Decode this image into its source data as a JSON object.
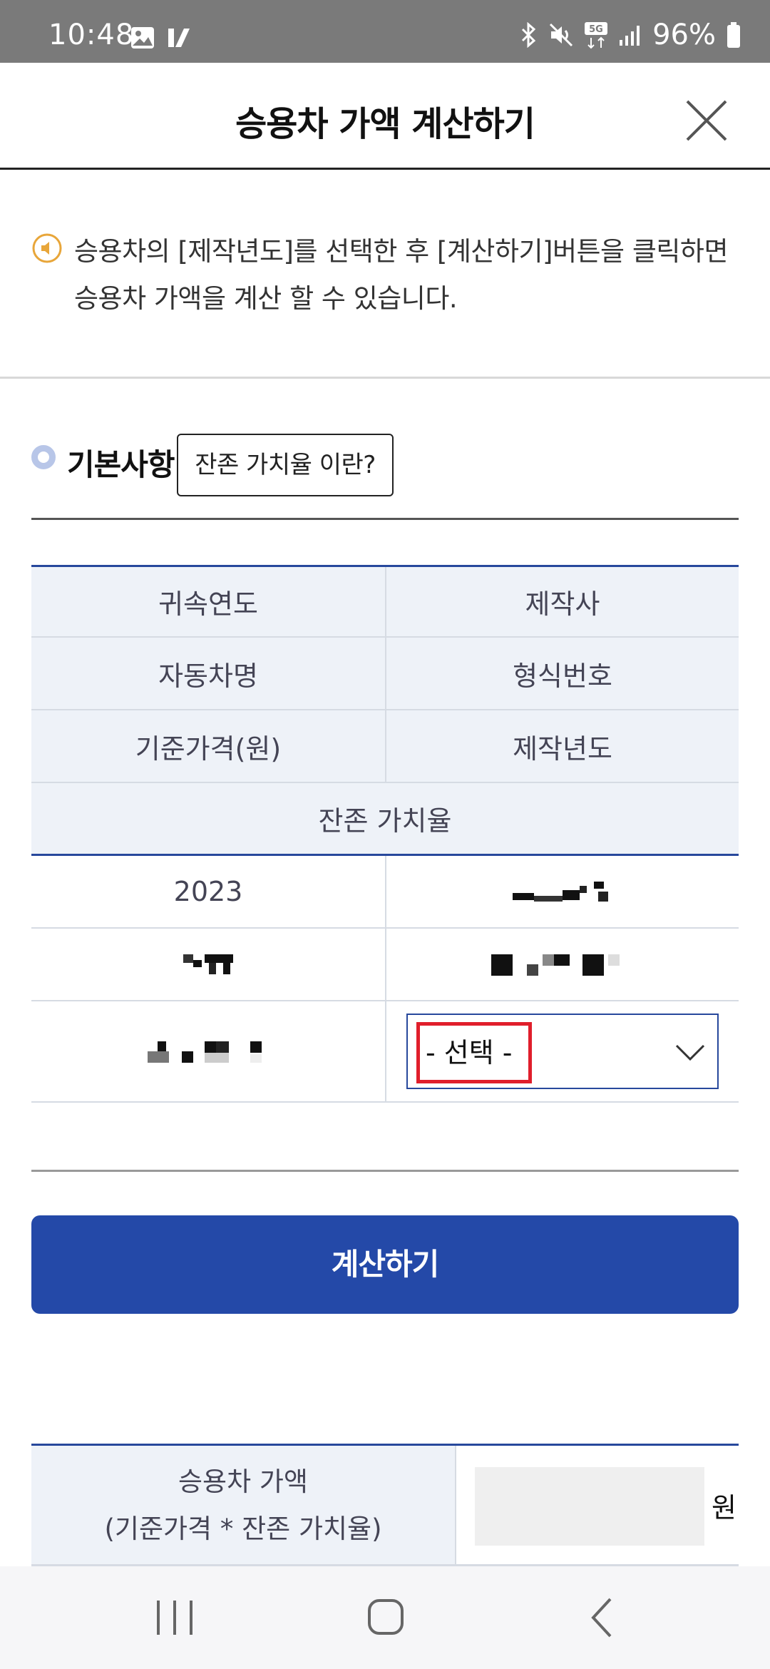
{
  "status": {
    "time": "10:48",
    "battery": "96%",
    "network": "5G"
  },
  "header": {
    "title": "승용차 가액 계산하기"
  },
  "notice": {
    "text_line1": "승용차의 [제작년도]를 선택한 후 [계산하기]버튼을 클릭하면",
    "text_line2": "승용차 가액을 계산 할 수 있습니다."
  },
  "section": {
    "title": "기본사항",
    "residual_button": "잔존 가치율 이란?"
  },
  "table": {
    "headers": {
      "year_of_attribution": "귀속연도",
      "manufacturer": "제작사",
      "car_name": "자동차명",
      "model_number": "형식번호",
      "base_price": "기준가격(원)",
      "production_year": "제작년도",
      "residual_rate": "잔존 가치율"
    },
    "values": {
      "year_of_attribution": "2023"
    },
    "select": {
      "selected": "- 선택 -"
    }
  },
  "actions": {
    "calculate": "계산하기"
  },
  "result": {
    "label_line1": "승용차 가액",
    "label_line2": "(기준가격 * 잔존 가치율)",
    "unit": "원"
  },
  "colors": {
    "primary": "#2449a8",
    "header_bg": "#eef2f8",
    "highlight": "#e01e2b"
  }
}
